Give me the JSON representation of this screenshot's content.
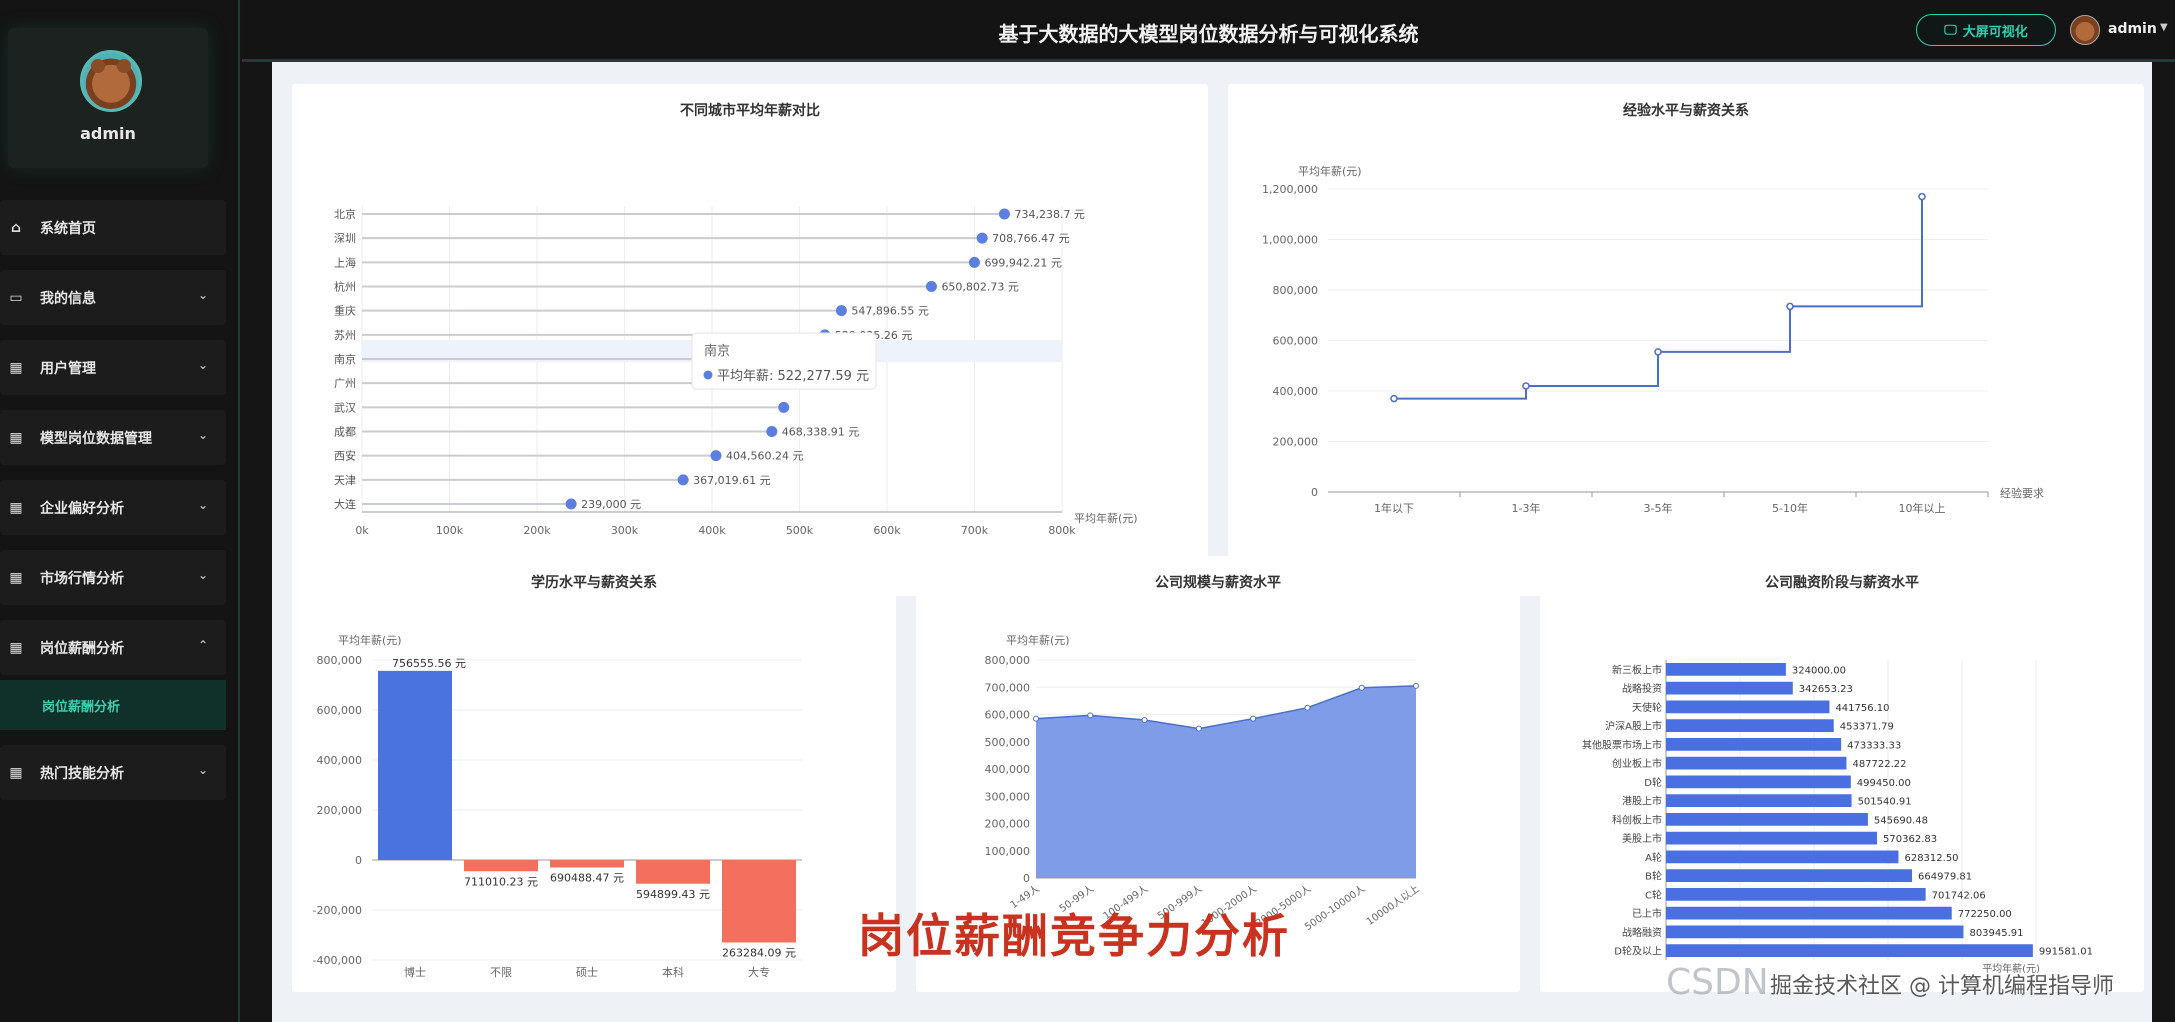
{
  "header": {
    "title": "基于大数据的大模型岗位数据分析与可视化系统",
    "bigscreen_label": "大屏可视化",
    "user_name": "admin"
  },
  "sidebar": {
    "profile_name": "admin",
    "items": [
      {
        "label": "系统首页",
        "icon": "home-icon",
        "expandable": false
      },
      {
        "label": "我的信息",
        "icon": "card-icon",
        "expandable": true
      },
      {
        "label": "用户管理",
        "icon": "grid-icon",
        "expandable": true
      },
      {
        "label": "模型岗位数据管理",
        "icon": "grid-icon",
        "expandable": true
      },
      {
        "label": "企业偏好分析",
        "icon": "grid-icon",
        "expandable": true
      },
      {
        "label": "市场行情分析",
        "icon": "grid-icon",
        "expandable": true
      },
      {
        "label": "岗位薪酬分析",
        "icon": "grid-icon",
        "expandable": true,
        "open": true
      },
      {
        "label": "热门技能分析",
        "icon": "grid-icon",
        "expandable": true
      }
    ],
    "active_sub": "岗位薪酬分析"
  },
  "overlay": {
    "caption": "岗位薪酬竞争力分析",
    "watermark": "CSDN",
    "watermark2": "掘金技术社区 @ 计算机编程指导师"
  },
  "chart_data": [
    {
      "id": "city",
      "type": "scatter",
      "title": "不同城市平均年薪对比",
      "categories": [
        "北京",
        "深圳",
        "上海",
        "杭州",
        "重庆",
        "苏州",
        "南京",
        "广州",
        "武汉",
        "成都",
        "西安",
        "天津",
        "大连"
      ],
      "values": [
        734238.7,
        708766.47,
        699942.21,
        650802.73,
        547896.55,
        529035.26,
        522277.59,
        505000,
        482000,
        468338.91,
        404560.24,
        367019.61,
        239000
      ],
      "labels": [
        "734,238.7 元",
        "708,766.47 元",
        "699,942.21 元",
        "650,802.73 元",
        "547,896.55 元",
        "529,035.26 元",
        "",
        "",
        "",
        "468,338.91 元",
        "404,560.24 元",
        "367,019.61 元",
        "239,000 元"
      ],
      "x_ticks": [
        "0k",
        "100k",
        "200k",
        "300k",
        "400k",
        "500k",
        "600k",
        "700k",
        "800k"
      ],
      "xlim": [
        0,
        800000
      ],
      "xlabel": "平均年薪(元)",
      "tooltip": {
        "city": "南京",
        "text": "平均年薪: 522,277.59 元"
      }
    },
    {
      "id": "experience",
      "type": "line",
      "title": "经验水平与薪资关系",
      "categories": [
        "1年以下",
        "1-3年",
        "3-5年",
        "5-10年",
        "10年以上"
      ],
      "values": [
        370000,
        420000,
        555000,
        735000,
        1170000
      ],
      "y_ticks": [
        "0",
        "200,000",
        "400,000",
        "600,000",
        "800,000",
        "1,000,000",
        "1,200,000"
      ],
      "ylim": [
        0,
        1200000
      ],
      "ylabel": "平均年薪(元)",
      "xlabel": "经验要求"
    },
    {
      "id": "education",
      "type": "bar",
      "title": "学历水平与薪资关系",
      "categories": [
        "博士",
        "不限",
        "硕士",
        "本科",
        "大专"
      ],
      "values": [
        756555.56,
        -45000,
        -30000,
        -95000,
        -330000
      ],
      "labels": [
        "756555.56 元",
        "711010.23 元",
        "690488.47 元",
        "594899.43 元",
        "263284.09 元"
      ],
      "y_ticks": [
        "-400,000",
        "-200,000",
        "0",
        "200,000",
        "400,000",
        "600,000",
        "800,000"
      ],
      "ylim": [
        -400000,
        800000
      ],
      "ylabel": "平均年薪(元)",
      "colors": {
        "positive": "#4a73e0",
        "negative": "#f4705e"
      }
    },
    {
      "id": "company_size",
      "type": "area",
      "title": "公司规模与薪资水平",
      "categories": [
        "1-49人",
        "50-99人",
        "100-499人",
        "500-999人",
        "1000-2000人",
        "2000-5000人",
        "5000-10000人",
        "10000人以上"
      ],
      "values": [
        585000,
        597000,
        580000,
        548000,
        585000,
        625000,
        698000,
        705000
      ],
      "y_ticks": [
        "0",
        "100,000",
        "200,000",
        "300,000",
        "400,000",
        "500,000",
        "600,000",
        "700,000",
        "800,000"
      ],
      "ylim": [
        0,
        800000
      ],
      "ylabel": "平均年薪(元)"
    },
    {
      "id": "funding",
      "type": "bar",
      "title": "公司融资阶段与薪资水平",
      "categories": [
        "新三板上市",
        "战略投资",
        "天使轮",
        "沪深A股上市",
        "其他股票市场上市",
        "创业板上市",
        "D轮",
        "港股上市",
        "科创板上市",
        "美股上市",
        "A轮",
        "B轮",
        "C轮",
        "已上市",
        "战略融资",
        "D轮及以上"
      ],
      "values": [
        324000.0,
        342653.23,
        441756.1,
        453371.79,
        473333.33,
        487722.22,
        499450.0,
        501540.91,
        545690.48,
        570362.83,
        628312.5,
        664979.81,
        701742.06,
        772250.0,
        803945.91,
        991581.01
      ],
      "labels": [
        "324000.00",
        "342653.23",
        "441756.10",
        "453371.79",
        "473333.33",
        "487722.22",
        "499450.00",
        "501540.91",
        "545690.48",
        "570362.83",
        "628312.50",
        "664979.81",
        "701742.06",
        "772250.00",
        "803945.91",
        "991581.01"
      ],
      "xlim": [
        0,
        1000000
      ],
      "xlabel": "平均年薪(元)"
    }
  ]
}
